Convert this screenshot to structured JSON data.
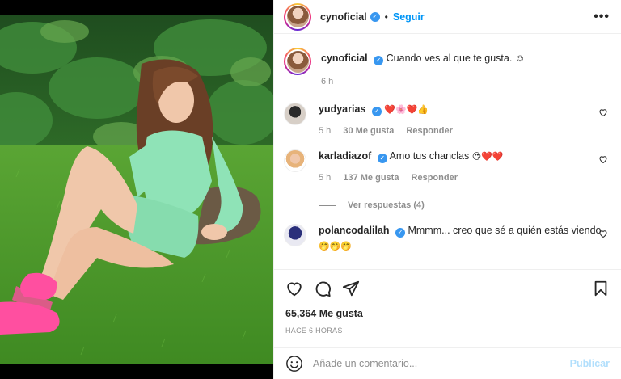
{
  "post": {
    "author": "cynoficial",
    "separator": "•",
    "follow_label": "Seguir",
    "more_icon": "more-horizontal-icon",
    "caption": "Cuando ves al que te gusta.",
    "caption_emoji": "☺",
    "caption_time": "6 h"
  },
  "comments": [
    {
      "user": "yudyarias",
      "text": "",
      "emojis": "❤️🌸❤️👍",
      "time": "5 h",
      "likes": "30 Me gusta",
      "reply": "Responder"
    },
    {
      "user": "karladiazof",
      "text": "Amo tus chanclas",
      "emojis": "😍❤️❤️",
      "time": "5 h",
      "likes": "137 Me gusta",
      "reply": "Responder",
      "view_replies": "Ver respuestas (4)"
    },
    {
      "user": "polancodalilah",
      "text": "Mmmm... creo que sé a quién estás viendo",
      "emojis": "🤭🤭🤭",
      "time": "",
      "likes": "",
      "reply": ""
    }
  ],
  "footer": {
    "likes": "65,364 Me gusta",
    "time": "HACE 6 HORAS",
    "comment_placeholder": "Añade un comentario...",
    "publish_label": "Publicar"
  },
  "colors": {
    "accent": "#0095f6",
    "verified": "#3897f0",
    "muted": "#8e8e8e",
    "publish_disabled": "#b2dffc",
    "sandal_pink": "#ff4fa0",
    "outfit_green": "#8fe3b7"
  }
}
